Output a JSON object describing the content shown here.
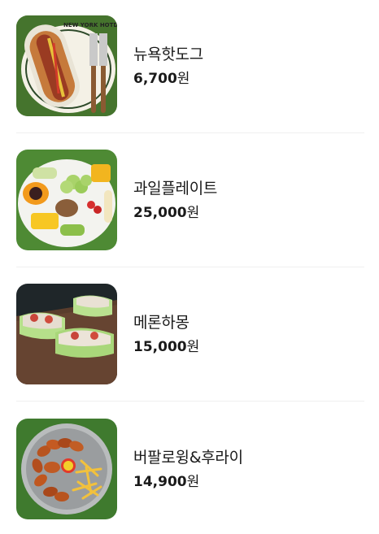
{
  "menu": {
    "items": [
      {
        "name": "뉴욕핫도그",
        "price": "6,700",
        "currency": "원",
        "image_text": "NEW YORK HOTDOG"
      },
      {
        "name": "과일플레이트",
        "price": "25,000",
        "currency": "원"
      },
      {
        "name": "메론하몽",
        "price": "15,000",
        "currency": "원"
      },
      {
        "name": "버팔로윙&후라이",
        "price": "14,900",
        "currency": "원"
      }
    ]
  }
}
